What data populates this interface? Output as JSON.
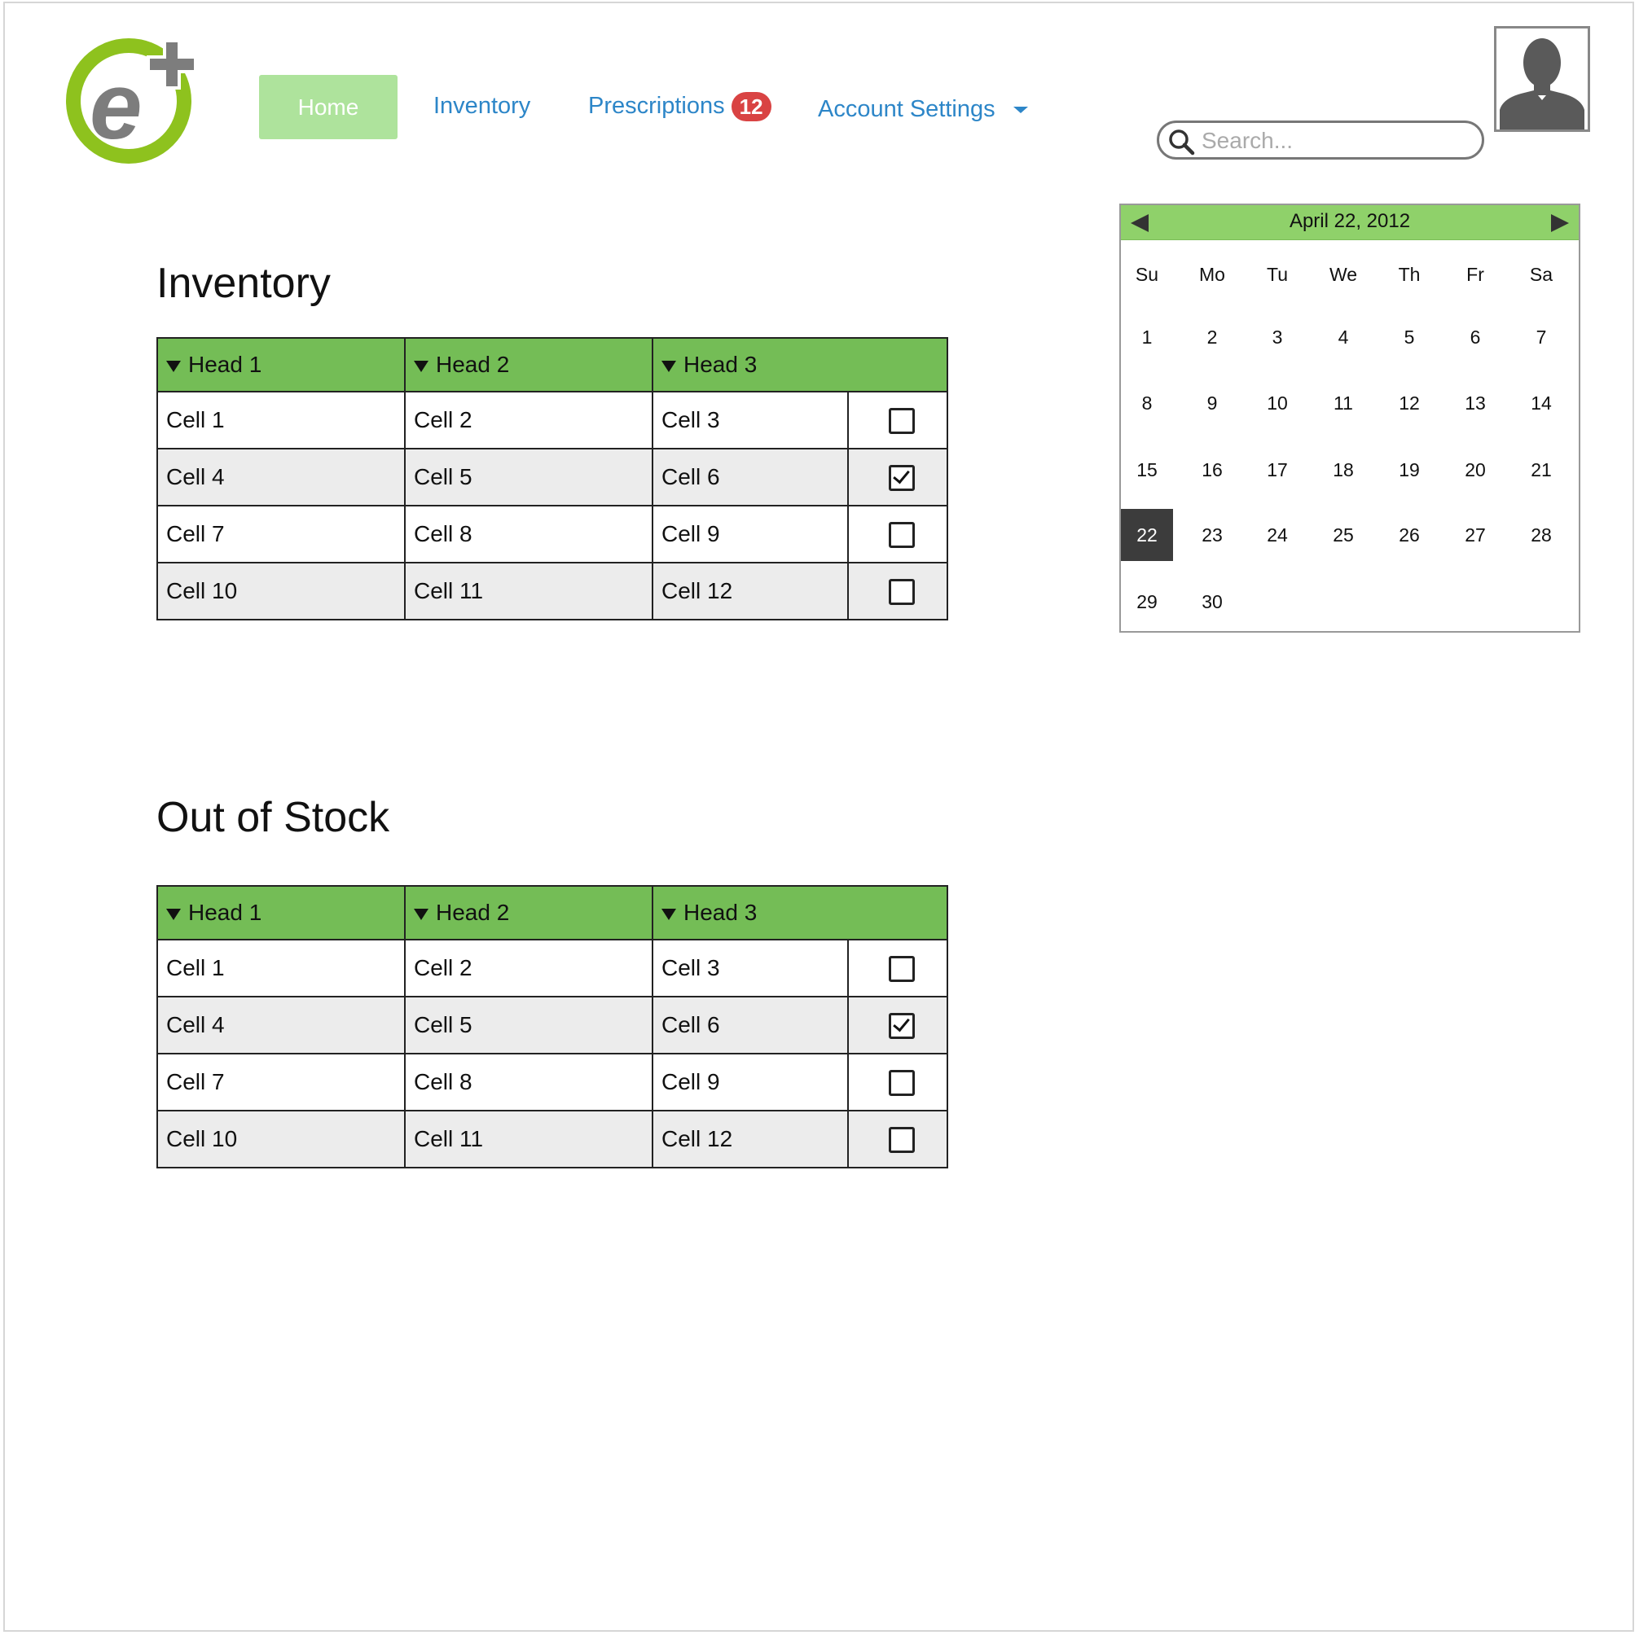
{
  "nav": {
    "home": "Home",
    "inventory": "Inventory",
    "prescriptions": "Prescriptions",
    "prescriptions_badge": "12",
    "account_settings": "Account Settings"
  },
  "search": {
    "placeholder": "Search..."
  },
  "calendar": {
    "title": "April 22, 2012",
    "weekdays": [
      "Su",
      "Mo",
      "Tu",
      "We",
      "Th",
      "Fr",
      "Sa"
    ],
    "weeks": [
      [
        "1",
        "2",
        "3",
        "4",
        "5",
        "6",
        "7"
      ],
      [
        "8",
        "9",
        "10",
        "11",
        "12",
        "13",
        "14"
      ],
      [
        "15",
        "16",
        "17",
        "18",
        "19",
        "20",
        "21"
      ],
      [
        "22",
        "23",
        "24",
        "25",
        "26",
        "27",
        "28"
      ],
      [
        "29",
        "30",
        "",
        "",
        "",
        "",
        ""
      ]
    ],
    "selected_day": "22"
  },
  "inventory": {
    "title": "Inventory",
    "headers": [
      "Head 1",
      "Head 2",
      "Head 3"
    ],
    "rows": [
      {
        "c1": "Cell 1",
        "c2": "Cell 2",
        "c3": "Cell 3",
        "checked": false
      },
      {
        "c1": "Cell 4",
        "c2": "Cell 5",
        "c3": "Cell 6",
        "checked": true
      },
      {
        "c1": "Cell 7",
        "c2": "Cell 8",
        "c3": "Cell 9",
        "checked": false
      },
      {
        "c1": "Cell 10",
        "c2": "Cell 11",
        "c3": "Cell 12",
        "checked": false
      }
    ]
  },
  "out_of_stock": {
    "title": "Out of Stock",
    "headers": [
      "Head 1",
      "Head 2",
      "Head 3"
    ],
    "rows": [
      {
        "c1": "Cell 1",
        "c2": "Cell 2",
        "c3": "Cell 3",
        "checked": false
      },
      {
        "c1": "Cell 4",
        "c2": "Cell 5",
        "c3": "Cell 6",
        "checked": true
      },
      {
        "c1": "Cell 7",
        "c2": "Cell 8",
        "c3": "Cell 9",
        "checked": false
      },
      {
        "c1": "Cell 10",
        "c2": "Cell 11",
        "c3": "Cell 12",
        "checked": false
      }
    ]
  },
  "colors": {
    "accent_green": "#74bd56",
    "home_button": "#aee39c",
    "calendar_header": "#8fd16a",
    "link_blue": "#2d86c8",
    "badge_red": "#d94343",
    "logo_green": "#8ec21e",
    "logo_gray": "#7d7d7d"
  },
  "icons": {
    "logo": "e-plus-logo",
    "search": "search-icon",
    "avatar": "user-silhouette-icon",
    "calendar_prev": "triangle-left-icon",
    "calendar_next": "triangle-right-icon",
    "sort": "triangle-down-icon",
    "dropdown": "caret-down-icon"
  }
}
